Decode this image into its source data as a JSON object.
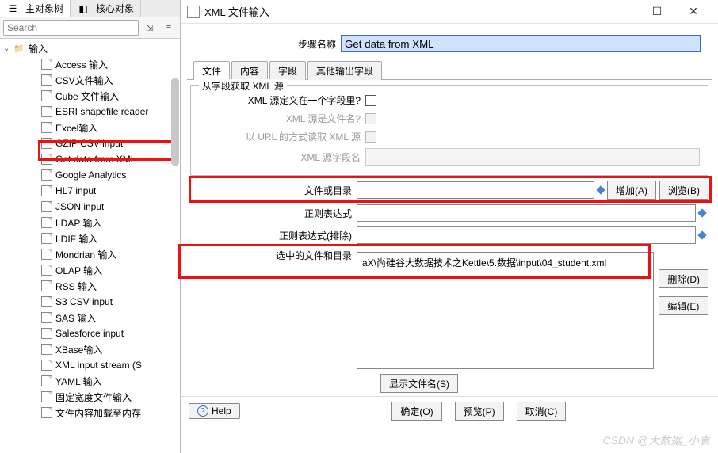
{
  "left": {
    "tab_active": "主对象树",
    "tab_core": "核心对象",
    "search_placeholder": "Search",
    "tree_root": "输入",
    "items": [
      "Access 输入",
      "CSV文件输入",
      "Cube 文件输入",
      "ESRI shapefile reader",
      "Excel输入",
      "GZIP CSV input",
      "Get data from XML",
      "Google Analytics",
      "HL7 input",
      "JSON input",
      "LDAP 输入",
      "LDIF 输入",
      "Mondrian 输入",
      "OLAP 输入",
      "RSS 输入",
      "S3 CSV input",
      "SAS 输入",
      "Salesforce input",
      "XBase输入",
      "XML input stream (S",
      "YAML 输入",
      "固定宽度文件输入",
      "文件内容加载至内存"
    ]
  },
  "dialog": {
    "title": "XML 文件输入",
    "step_label": "步骤名称",
    "step_value": "Get data from XML",
    "tabs": [
      "文件",
      "内容",
      "字段",
      "其他输出字段"
    ],
    "group_title": "从字段获取 XML 源",
    "row_xml_in_field": "XML 源定义在一个字段里?",
    "row_xml_is_file": "XML 源是文件名?",
    "row_read_url": "以 URL 的方式读取 XML 源",
    "row_xml_field": "XML 源字段名",
    "row_file_or_dir": "文件或目录",
    "btn_add": "增加(A)",
    "btn_browse": "浏览(B)",
    "row_regex": "正则表达式",
    "row_regex_exclude": "正则表达式(排除)",
    "row_selected": "选中的文件和目录",
    "selected_path": "aX\\尚硅谷大数据技术之Kettle\\5.数据\\input\\04_student.xml",
    "btn_delete": "删除(D)",
    "btn_edit": "编辑(E)",
    "btn_show_names": "显示文件名(S)",
    "btn_help": "Help",
    "btn_ok": "确定(O)",
    "btn_preview": "预览(P)",
    "btn_cancel": "取消(C)"
  },
  "watermark": "CSDN @大数据_小袁"
}
